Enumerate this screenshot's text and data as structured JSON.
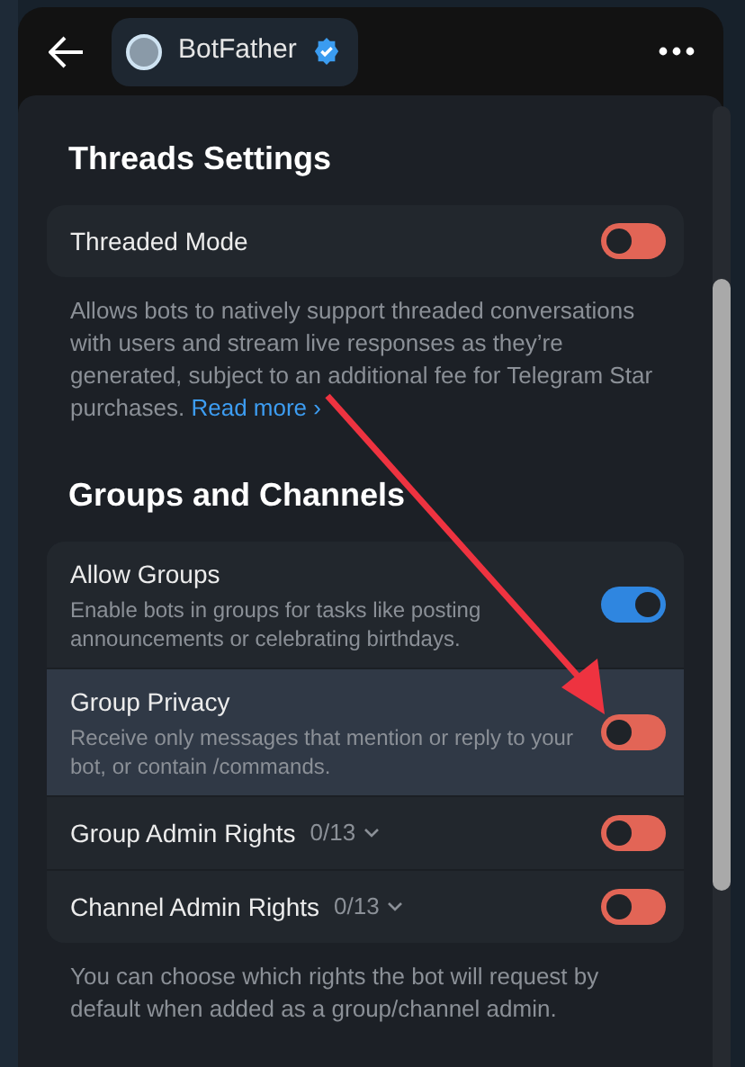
{
  "header": {
    "title": "BotFather",
    "verified": true
  },
  "sections": [
    {
      "title": "Threads Settings",
      "rows": [
        {
          "kind": "toggle",
          "label": "Threaded Mode",
          "on": false,
          "highlighted": false
        }
      ],
      "footer": "Allows bots to natively support threaded conversations with users and stream live responses as they’re generated, subject to an additional fee for Telegram Star purchases.",
      "footer_link": "Read more ›"
    },
    {
      "title": "Groups and Channels",
      "rows": [
        {
          "kind": "toggle",
          "label": "Allow Groups",
          "description": "Enable bots in groups for tasks like posting announcements or celebrating birthdays.",
          "on": true,
          "highlighted": false
        },
        {
          "kind": "toggle",
          "label": "Group Privacy",
          "description": "Receive only messages that mention or reply to your bot, or contain /commands.",
          "on": false,
          "highlighted": true
        },
        {
          "kind": "expandable",
          "label": "Group Admin Rights",
          "count": "0/13",
          "on": false,
          "highlighted": false
        },
        {
          "kind": "expandable",
          "label": "Channel Admin Rights",
          "count": "0/13",
          "on": false,
          "highlighted": false
        }
      ],
      "footer": "You can choose which rights the bot will request by default when added as a group/channel admin."
    }
  ]
}
